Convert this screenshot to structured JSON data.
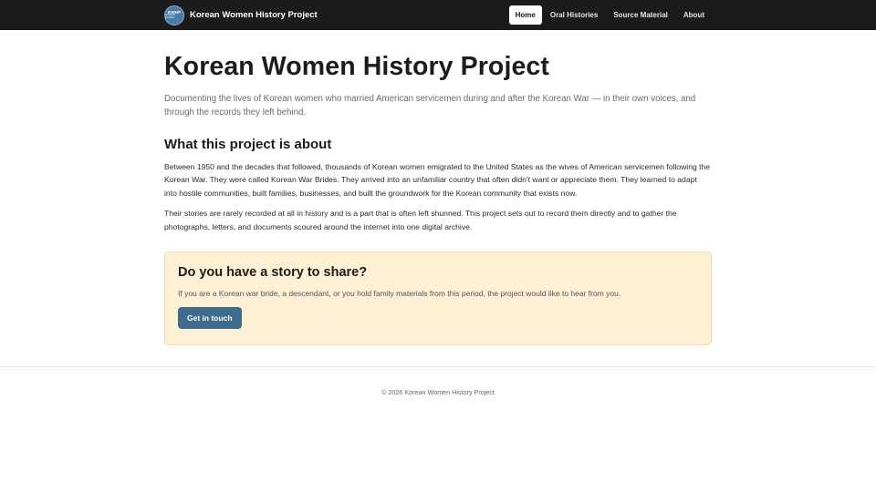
{
  "header": {
    "logo_text": "KWHP",
    "logo_subtext": "KOREAN WOMEN",
    "brand": "Korean Women History Project",
    "nav": [
      {
        "label": "Home",
        "active": true
      },
      {
        "label": "Oral Histories",
        "active": false
      },
      {
        "label": "Source Material",
        "active": false
      },
      {
        "label": "About",
        "active": false
      }
    ]
  },
  "main": {
    "title": "Korean Women History Project",
    "lede": "Documenting the lives of Korean women who married American servicemen during and after the Korean War — in their own voices, and through the records they left behind.",
    "about_heading": "What this project is about",
    "about_paragraphs": [
      "Between 1950 and the decades that followed, thousands of Korean women emigrated to the United States as the wives of American servicemen following the Korean War. They were called Korean War Brides. They arrived into an unfamiliar country that often didn't want or appreciate them. They learned to adapt into hostile communities, built families, businesses, and built the groundwork for the Korean community that exists now.",
      "Their stories are rarely recorded at all in history and is a part that is often left shunned. This project sets out to record them directly and to gather the photographs, letters, and documents scoured around the internet into one digital archive."
    ],
    "callout": {
      "heading": "Do you have a story to share?",
      "text": "If you are a Korean war bride, a descendant, or you hold family materials from this period, the project would like to hear from you.",
      "button": "Get in touch"
    }
  },
  "footer": {
    "text": "© 2026 Korean Women History Project"
  },
  "colors": {
    "navbar": "#1b1b1b",
    "callout_bg": "#fdf0d4",
    "button": "#3f6b8c"
  }
}
